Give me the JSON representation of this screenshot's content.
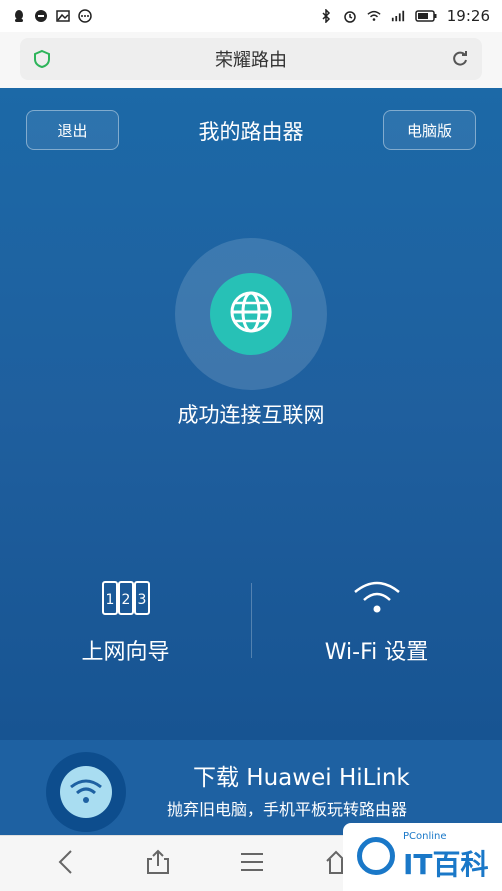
{
  "status_bar": {
    "time": "19:26",
    "left_icons": [
      "qq-icon",
      "qq-browser-icon",
      "image-icon",
      "more-icon"
    ],
    "right_icons": [
      "bluetooth-icon",
      "alarm-icon",
      "wifi-icon",
      "signal-icon",
      "battery-icon"
    ]
  },
  "address_bar": {
    "title": "荣耀路由"
  },
  "app": {
    "title": "我的路由器",
    "logout_label": "退出",
    "pc_label": "电脑版",
    "status_text": "成功连接互联网",
    "features": [
      {
        "label": "上网向导",
        "icon": "numbered-steps-icon"
      },
      {
        "label": "Wi-Fi 设置",
        "icon": "wifi-icon"
      }
    ]
  },
  "banner": {
    "title": "下载 Huawei HiLink",
    "subtitle": "抛弃旧电脑，手机平板玩转路由器"
  },
  "watermark": {
    "small": "PConline",
    "text": "IT百科"
  },
  "colors": {
    "app_bg_top": "#1c69a7",
    "app_bg_bottom": "#175492",
    "status_core": "#27c1b6",
    "banner_icon": "#a9ddf1",
    "brand": "#1a78c8"
  }
}
